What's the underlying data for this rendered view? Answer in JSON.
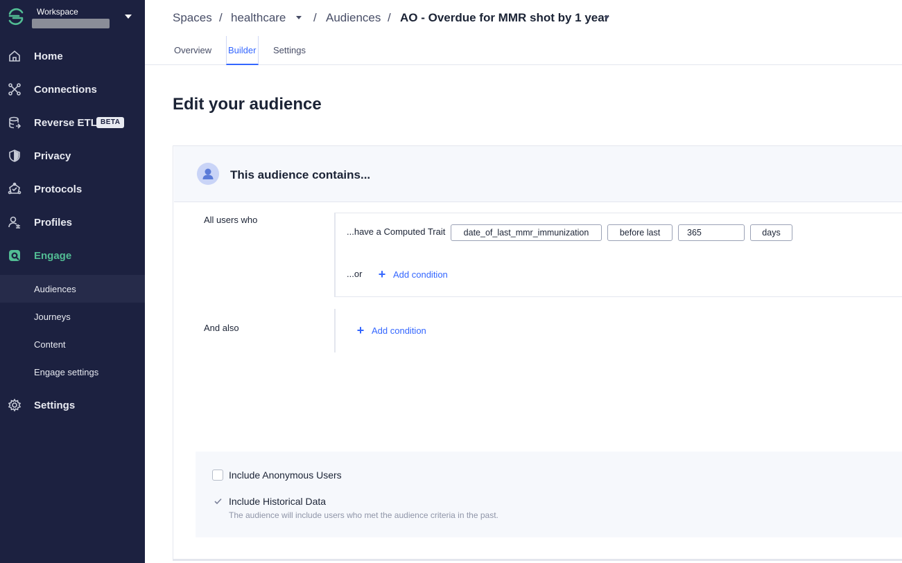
{
  "workspace": {
    "label": "Workspace",
    "name": ""
  },
  "nav": {
    "home": "Home",
    "connections": "Connections",
    "reverse_etl": "Reverse ETL",
    "reverse_etl_badge": "BETA",
    "privacy": "Privacy",
    "protocols": "Protocols",
    "profiles": "Profiles",
    "engage": "Engage",
    "settings": "Settings",
    "sub": {
      "audiences": "Audiences",
      "journeys": "Journeys",
      "content": "Content",
      "engage_settings": "Engage settings"
    }
  },
  "breadcrumb": {
    "spaces": "Spaces",
    "space": "healthcare",
    "audiences": "Audiences",
    "audience": "AO - Overdue for MMR shot by 1 year",
    "sep": "/"
  },
  "tabs": {
    "overview": "Overview",
    "builder": "Builder",
    "settings": "Settings"
  },
  "page_title": "Edit your audience",
  "card": {
    "title": "This audience contains..."
  },
  "rule": {
    "all_users_label": "All users who",
    "condition_prefix": "...have a Computed Trait",
    "trait": "date_of_last_mmr_immunization",
    "operator": "before last",
    "value": "365",
    "unit": "days",
    "or_label": "...or",
    "add_condition": "Add condition",
    "and_also_label": "And also"
  },
  "options": {
    "anonymous_label": "Include Anonymous Users",
    "anonymous_checked": false,
    "historical_label": "Include Historical Data",
    "historical_checked": true,
    "historical_desc": "The audience will include users who met the audience criteria in the past."
  },
  "colors": {
    "sidebar_bg": "#1c2140",
    "accent_green": "#52bd94",
    "link_blue": "#3366ff"
  }
}
